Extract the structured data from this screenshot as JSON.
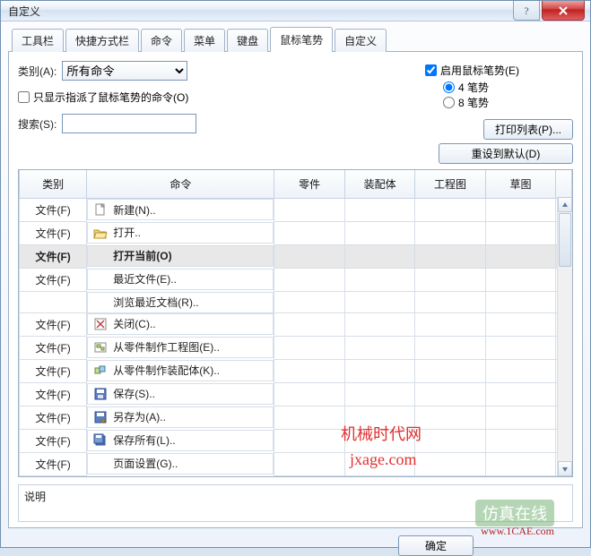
{
  "window": {
    "title": "自定义"
  },
  "tabs": {
    "items": [
      {
        "label": "工具栏"
      },
      {
        "label": "快捷方式栏"
      },
      {
        "label": "命令"
      },
      {
        "label": "菜单"
      },
      {
        "label": "键盘"
      },
      {
        "label": "鼠标笔势"
      },
      {
        "label": "自定义"
      }
    ]
  },
  "labels": {
    "category": "类别(A):",
    "only_assigned": "只显示指派了鼠标笔势的命令(O)",
    "search": "搜索(S):",
    "enable_gestures": "启用鼠标笔势(E)",
    "gesture4": "4 笔势",
    "gesture8": "8 笔势",
    "description": "说明"
  },
  "combo": {
    "value": "所有命令"
  },
  "buttons": {
    "print_list": "打印列表(P)...",
    "reset_defaults": "重设到默认(D)",
    "ok": "确定"
  },
  "table": {
    "headers": {
      "category": "类别",
      "command": "命令",
      "part": "零件",
      "assembly": "装配体",
      "drawing": "工程图",
      "sketch": "草图"
    },
    "rows": [
      {
        "cat": "文件(F)",
        "cmd": "新建(N)..",
        "icon": "new"
      },
      {
        "cat": "文件(F)",
        "cmd": "打开..",
        "icon": "open"
      },
      {
        "cat": "文件(F)",
        "cmd": "打开当前(O)",
        "icon": "",
        "selected": true
      },
      {
        "cat": "文件(F)",
        "cmd": "最近文件(E)..",
        "icon": ""
      },
      {
        "cat": "",
        "cmd": "浏览最近文档(R)..",
        "icon": ""
      },
      {
        "cat": "文件(F)",
        "cmd": "关闭(C)..",
        "icon": "close"
      },
      {
        "cat": "文件(F)",
        "cmd": "从零件制作工程图(E)..",
        "icon": "makedrw"
      },
      {
        "cat": "文件(F)",
        "cmd": "从零件制作装配体(K)..",
        "icon": "makeasm"
      },
      {
        "cat": "文件(F)",
        "cmd": "保存(S)..",
        "icon": "save"
      },
      {
        "cat": "文件(F)",
        "cmd": "另存为(A)..",
        "icon": "saveas"
      },
      {
        "cat": "文件(F)",
        "cmd": "保存所有(L)..",
        "icon": "saveall"
      },
      {
        "cat": "文件(F)",
        "cmd": "页面设置(G)..",
        "icon": ""
      }
    ]
  },
  "search": {
    "value": ""
  },
  "checks": {
    "only_assigned": false,
    "enable_gestures": true,
    "gesture": "4"
  },
  "watermarks": {
    "w1": "机械时代网",
    "w2": "jxage.com",
    "sim": "仿真在线",
    "simurl": "www.1CAE.com"
  }
}
